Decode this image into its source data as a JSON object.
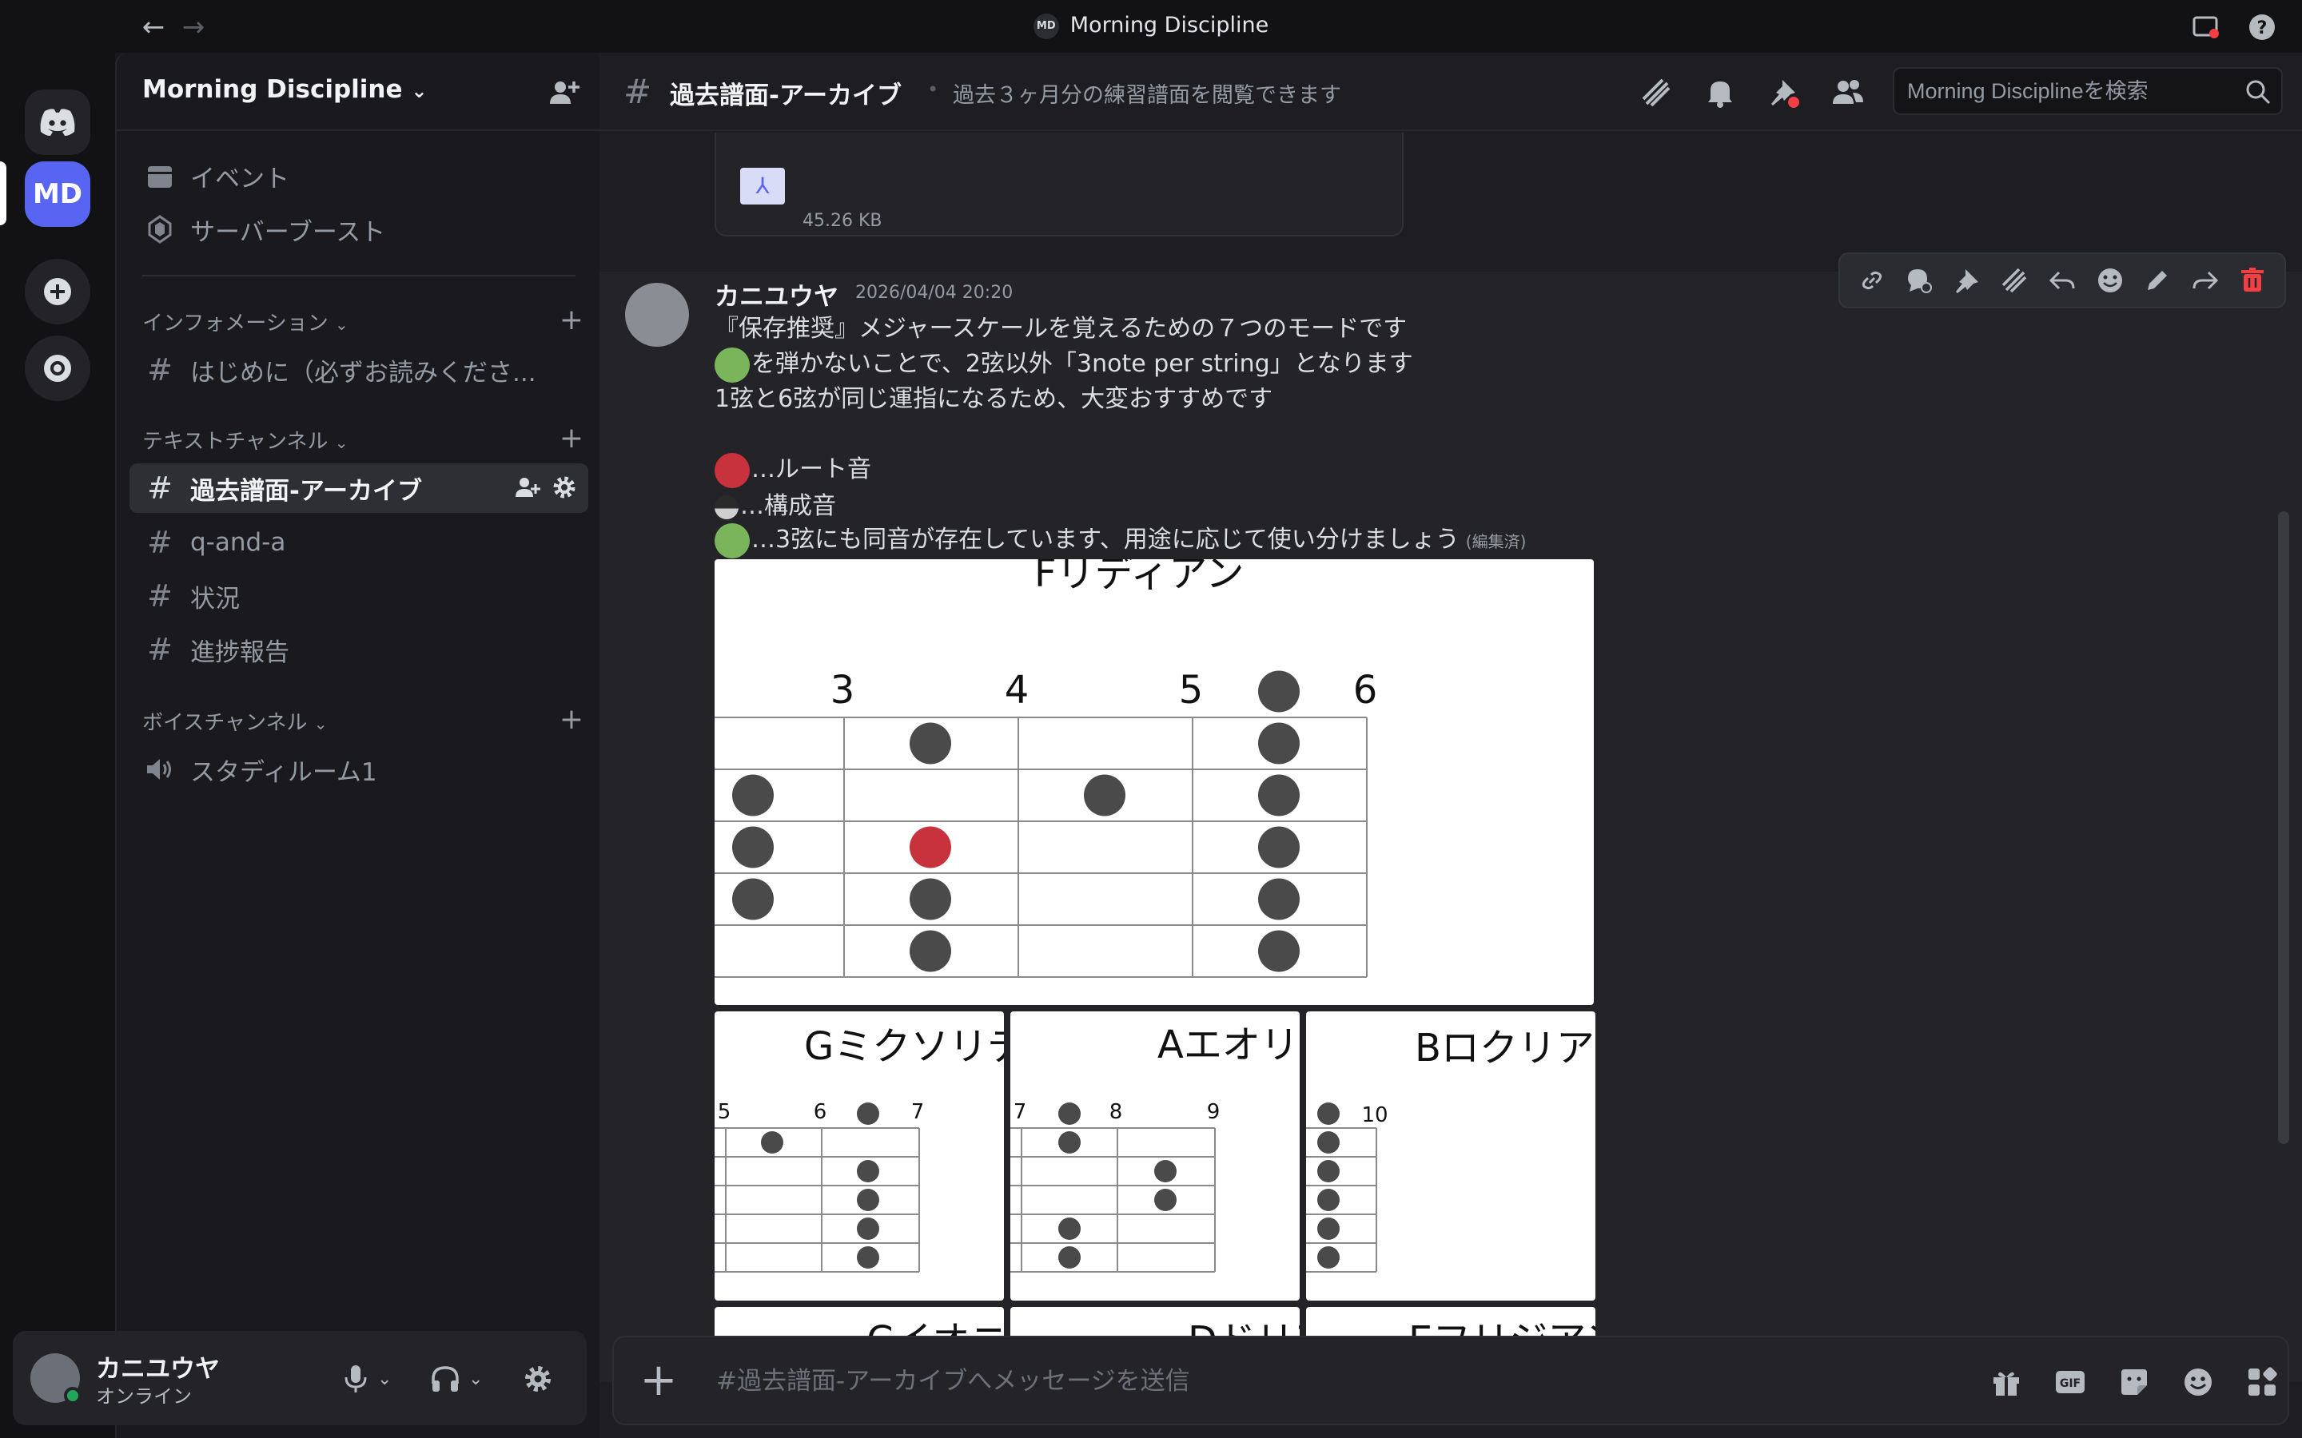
{
  "window": {
    "title": "Morning Discipline",
    "badge": "MD"
  },
  "rail": {
    "server_abbrev": "MD"
  },
  "server": {
    "name": "Morning Discipline"
  },
  "sidebar": {
    "top_items": [
      {
        "label": "イベント"
      },
      {
        "label": "サーバーブースト"
      }
    ],
    "categories": [
      {
        "label": "インフォメーション",
        "channels": [
          {
            "label": "はじめに（必ずお読みくださ..."
          }
        ]
      },
      {
        "label": "テキストチャンネル",
        "channels": [
          {
            "label": "過去譜面-アーカイブ",
            "active": true
          },
          {
            "label": "q-and-a"
          },
          {
            "label": "状況"
          },
          {
            "label": "進捗報告"
          }
        ]
      },
      {
        "label": "ボイスチャンネル",
        "channels": [
          {
            "label": "スタディルーム1"
          }
        ]
      }
    ]
  },
  "user": {
    "name": "カニユウヤ",
    "status": "オンライン"
  },
  "channel": {
    "name": "過去譜面-アーカイブ",
    "topic": "過去３ヶ月分の練習譜面を閲覧できます",
    "search_placeholder": "Morning Disciplineを検索",
    "composer_placeholder": "#過去譜面-アーカイブへメッセージを送信"
  },
  "prev_attachment": {
    "size": "45.26 KB"
  },
  "message": {
    "author": "カニユウヤ",
    "timestamp": "2026/04/04 20:20",
    "lines": [
      "『保存推奨』メジャースケールを覚えるための７つのモードです",
      "を弾かないことで、2弦以外「3note per string」となります",
      "1弦と6弦が同じ運指になるため、大変おすすめです",
      "…ルート音",
      "…構成音",
      "…3弦にも同音が存在しています、用途に応じて使い分けましょう"
    ],
    "edited": "(編集済)"
  },
  "images": {
    "main": {
      "title": "Fリディアン",
      "frets": [
        "3",
        "4",
        "5",
        "6"
      ]
    },
    "grid": [
      {
        "title": "Gミクソリディアン",
        "frets": [
          "5",
          "6",
          "7"
        ]
      },
      {
        "title": "Aエオリアン",
        "frets": [
          "7",
          "8",
          "9"
        ]
      },
      {
        "title": "Bロクリアン",
        "frets": [
          "10"
        ]
      },
      {
        "title": "Cイオニアン"
      },
      {
        "title": "Dドリアン"
      },
      {
        "title": "Eフリジアン"
      }
    ]
  },
  "colors": {
    "root": "#c8323c",
    "green": "#7ab55c",
    "note": "#4a4a4a",
    "accent": "#5865f2"
  }
}
